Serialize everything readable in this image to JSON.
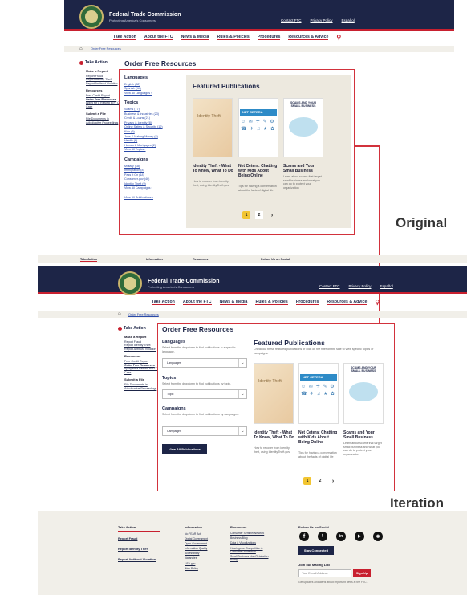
{
  "original": {
    "agency_name": "Federal Trade Commission",
    "tagline": "Protecting America's Consumers",
    "utility_links": [
      "Contact FTC",
      "Privacy Policy",
      "Español"
    ],
    "nav": [
      "Take Action",
      "About the FTC",
      "News & Media",
      "Rules & Policies",
      "Procedures",
      "Resources & Advice"
    ],
    "breadcrumb": "Order Free Resources",
    "page_title": "Order Free Resources",
    "sidebar": {
      "heading": "Take Action",
      "make_report": "Make a Report",
      "report_links": [
        "Report Fraud",
        "Report Identity Theft",
        "Report Antitrust Violation"
      ],
      "resources_heading": "Resources",
      "resource_links": [
        "Free Credit Report",
        "Order Free Resources",
        "Apply for a Refund in FTC Case"
      ],
      "submit_heading": "Submit a File",
      "submit_links": [
        "File Documents in Adjudicative Proceedings"
      ]
    },
    "filters": {
      "languages_heading": "Languages",
      "languages": [
        "English (82)",
        "Spanish (44)",
        "View All Languages ›"
      ],
      "topics_heading": "Topics",
      "topics": [
        "Scams (77)",
        "Business & Industries (23)",
        "Credit & Loans (21)",
        "Privacy & Identity (8)",
        "Online Safety & Security (10)",
        "Kids (9)",
        "Jobs & Making Money (8)",
        "Health (6)",
        "Homes & Mortgages (2)",
        "View All Topics ›"
      ],
      "campaigns_heading": "Campaigns",
      "campaigns": [
        "Military (18)",
        "Immigration (8)",
        "Pass It On (18)",
        "Consumer.gov (46)",
        "Identity Theft (9)",
        "View All Campaigns ›"
      ],
      "view_all": "View All Publications ›"
    },
    "featured_heading": "Featured Publications",
    "publications": [
      {
        "title": "Identity Theft - What To Know, What To Do",
        "desc": "How to recover from identity theft, using IdentityTheft.gov",
        "thumb_text": "Identity Theft"
      },
      {
        "title": "Net Cetera: Chatting with Kids About Being Online",
        "desc": "Tips for having a conversation about the facts of digital life",
        "thumb_text": "NET CETERA"
      },
      {
        "title": "Scams and Your Small Business",
        "desc": "Learn about scams that target small business and what you can do to protect your organization",
        "thumb_text": "SCAMS AND YOUR SMALL BUSINESS"
      }
    ],
    "pages": [
      "1",
      "2",
      "›"
    ]
  },
  "labels": {
    "original": "Original",
    "iteration": "Iteration"
  },
  "iteration": {
    "top_strip": [
      "Take Action",
      "Information",
      "Resources",
      "Follow Us on Social"
    ],
    "agency_name": "Federal Trade Commission",
    "tagline": "Protecting America's Consumers",
    "utility_links": [
      "Contact FTC",
      "Privacy Policy",
      "Español"
    ],
    "nav": [
      "Take Action",
      "About the FTC",
      "News & Media",
      "Rules & Policies",
      "Procedures",
      "Resources & Advice"
    ],
    "breadcrumb": "Order Free Resources",
    "page_title": "Order Free Resources",
    "sidebar": {
      "heading": "Take Action",
      "make_report": "Make a Report",
      "report_links": [
        "Report Fraud",
        "Report Identity Theft",
        "Report Antitrust Violation"
      ],
      "resources_heading": "Resources",
      "resource_links": [
        "Free Credit Report",
        "Order Free Resources",
        "Apply for a Refund in FTC Case"
      ],
      "submit_heading": "Submit a File",
      "submit_links": [
        "File Documents in Adjudicative Proceedings"
      ]
    },
    "filters": {
      "languages_heading": "Languages",
      "languages_help": "Select from the dropdown to find publications in a specific language.",
      "languages_value": "Languages",
      "topics_heading": "Topics",
      "topics_help": "Select from the dropdown to find publications by topic.",
      "topics_value": "Topic",
      "campaigns_heading": "Campaigns",
      "campaigns_help": "Select from the dropdown to find publications by campaigns.",
      "campaigns_value": "Campaigns",
      "view_all": "View All Publications"
    },
    "featured_heading": "Featured Publications",
    "featured_help": "Check out these featured publications or click on the filter on the side to view specific topics or campaigns.",
    "publications": [
      {
        "title": "Identity Theft - What To Know, What To Do",
        "desc": "How to recover from identity theft, using IdentityTheft.gov",
        "thumb_text": "Identity Theft"
      },
      {
        "title": "Net Cetera: Chatting with Kids About Being Online",
        "desc": "Tips for having a conversation about the facts of digital life",
        "thumb_text": "NET CETERA"
      },
      {
        "title": "Scams and Your Small Business",
        "desc": "Learn about scams that target small business and what you can do to protect your organization",
        "thumb_text": "SCAMS AND YOUR SMALL BUSINESS"
      }
    ],
    "pages": [
      "1",
      "2",
      "›"
    ],
    "footer": {
      "col1_heading": "Take Action",
      "col1": [
        "Report Fraud",
        "Report Identity Theft",
        "Report Antitrust Violation"
      ],
      "col2_heading": "Information",
      "col2": [
        "No FEAR Act",
        "Digital Government",
        "Open Government",
        "Information Quality",
        "Accessibility",
        "Vacancies",
        "USA.gov",
        "Web Policy"
      ],
      "col3_heading": "Resources",
      "col3": [
        "Consumer Sentinel Network",
        "Business Blog",
        "Data & Visualizations",
        "Hearings on Competition & Consumer Protection",
        "Small Business Non-Retaliation Policy"
      ],
      "social_heading": "Follow Us on Social",
      "social_icons": [
        "facebook-icon",
        "twitter-icon",
        "linkedin-icon",
        "youtube-icon",
        "rss-icon"
      ],
      "stay_connected": "Stay Connected",
      "mailing_heading": "Join our Mailing List",
      "email_placeholder": "Your E-mail Address",
      "signup": "Sign Up",
      "mailing_note": "Get updates and alerts about important news at the FTC."
    }
  }
}
